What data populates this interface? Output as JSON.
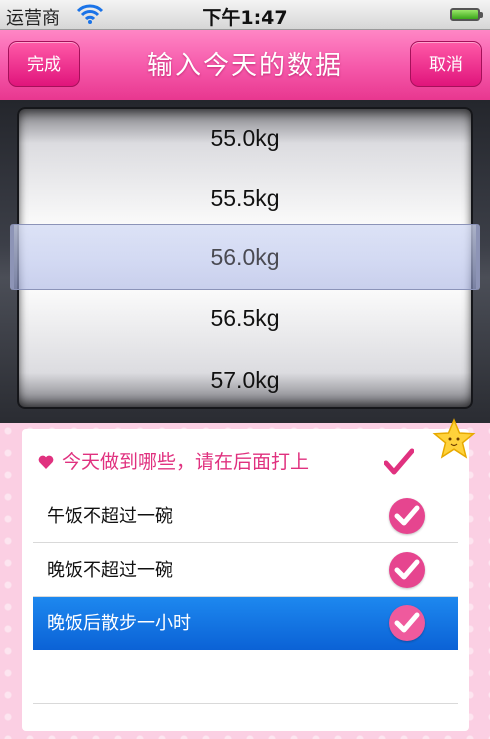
{
  "status_bar": {
    "carrier": "运营商",
    "time": "下午1:47"
  },
  "nav": {
    "title": "输入今天的数据",
    "left_button": "完成",
    "right_button": "取消"
  },
  "picker": {
    "options": [
      "55.0kg",
      "55.5kg",
      "56.0kg",
      "56.5kg",
      "57.0kg"
    ],
    "selected": "56.0kg"
  },
  "checklist": {
    "header": "今天做到哪些，请在后面打上",
    "items": [
      {
        "label": "午饭不超过一碗",
        "checked": true,
        "selected": false
      },
      {
        "label": "晚饭不超过一碗",
        "checked": true,
        "selected": false
      },
      {
        "label": "晚饭后散步一小时",
        "checked": true,
        "selected": true
      }
    ]
  },
  "colors": {
    "accent_pink": "#f557a9",
    "selection_blue": "#0b62d6",
    "check_pink": "#e6458f"
  }
}
